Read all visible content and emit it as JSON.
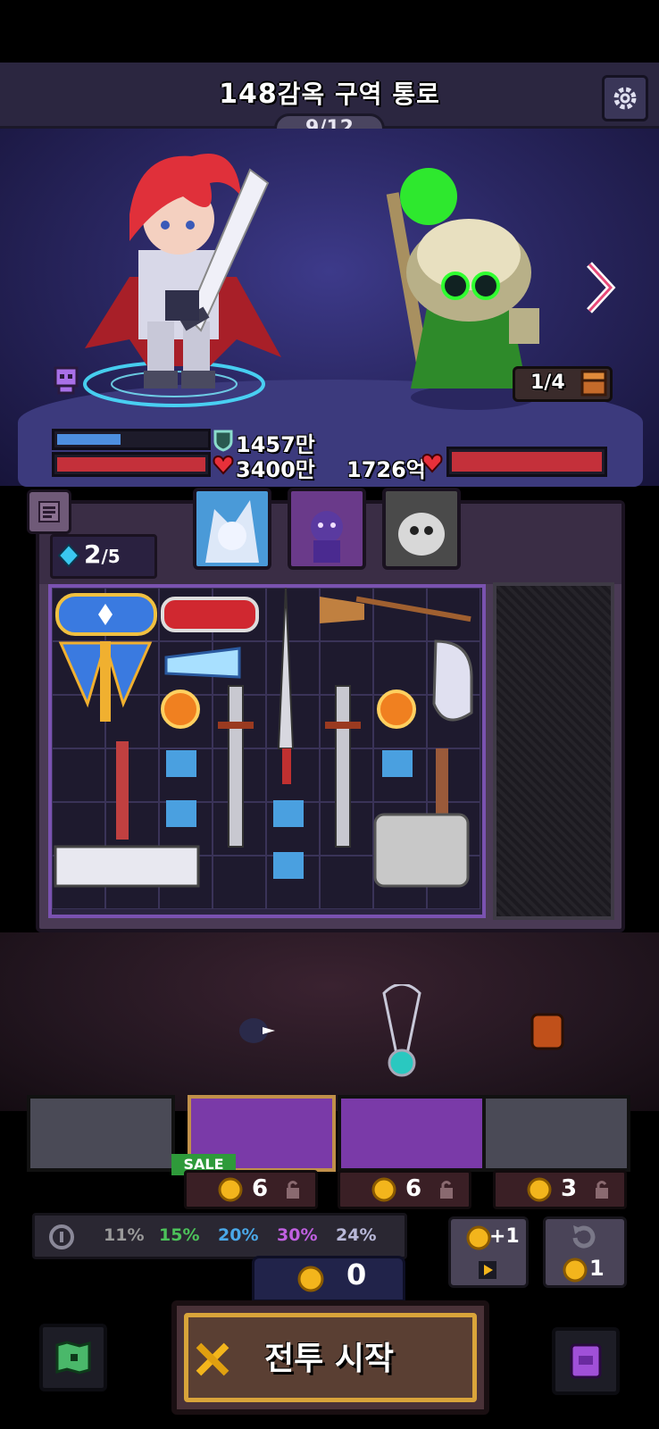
{
  "header": {
    "stage_number": "148",
    "stage_name": "감옥 구역 통로",
    "wave_progress": "9/12"
  },
  "battle": {
    "hero_shield": "1457만",
    "hero_hp": "3400만",
    "enemy_hp": "1726억",
    "hero_shield_fill": 0.45,
    "hero_hp_fill": 1.0,
    "enemy_hp_fill": 1.0,
    "enemy_count": "1/4"
  },
  "inventory": {
    "gems": "2",
    "gems_max": "/5",
    "characters": [
      "white-wolf-knight",
      "purple-shadow-imp",
      "grey-ghost-cat"
    ]
  },
  "shop": {
    "sale_label": "SALE",
    "slots": [
      {
        "price": "6",
        "style": "purple",
        "sale": true
      },
      {
        "price": "6",
        "style": "purple",
        "sale": false
      },
      {
        "price": "3",
        "style": "grey",
        "sale": false
      }
    ],
    "odds": [
      "11%",
      "15%",
      "20%",
      "30%",
      "24%"
    ],
    "odds_colors": [
      "#9a9a9a",
      "#4cc25a",
      "#4aa8e8",
      "#c060e0",
      "#b8b8d8"
    ]
  },
  "buttons": {
    "reroll_bonus": "+1",
    "refresh_cost": "1",
    "gold": "0",
    "start_battle": "전투 시작"
  },
  "colors": {
    "accent_gold": "#f3b51c",
    "hp_red": "#c4303a",
    "shield_blue": "#4d8fe0",
    "panel_purple": "#7a52b0"
  }
}
